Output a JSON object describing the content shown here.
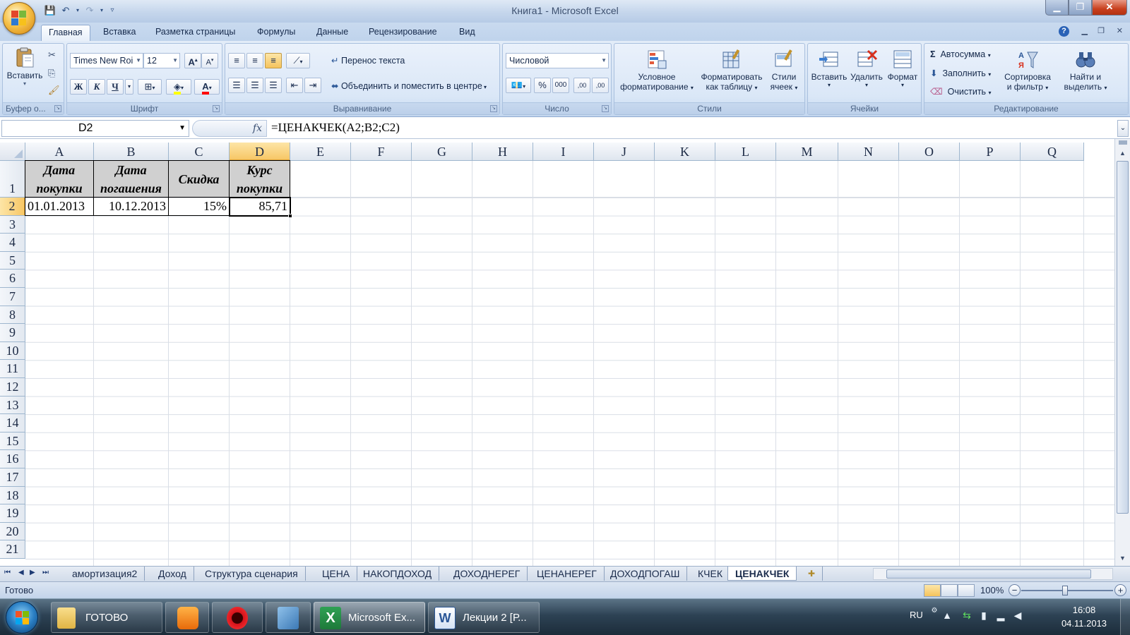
{
  "window": {
    "title": "Книга1 - Microsoft Excel",
    "minimize": "▁",
    "maximize": "❐",
    "close": "✕"
  },
  "ribbon_tabs": [
    "Главная",
    "Вставка",
    "Разметка страницы",
    "Формулы",
    "Данные",
    "Рецензирование",
    "Вид"
  ],
  "active_ribbon_tab": "Главная",
  "groups": {
    "clipboard": {
      "label": "Буфер о...",
      "paste": "Вставить"
    },
    "font": {
      "label": "Шрифт",
      "font_name": "Times New Roi",
      "font_size": "12",
      "bold": "Ж",
      "italic": "К",
      "underline": "Ч"
    },
    "alignment": {
      "label": "Выравнивание",
      "wrap_text": "Перенос текста",
      "merge_center": "Объединить и поместить в центре"
    },
    "number": {
      "label": "Число",
      "format": "Числовой",
      "percent": "%",
      "thousands": "000",
      "inc_decimal": ",00",
      "dec_decimal": ",00"
    },
    "styles": {
      "label": "Стили",
      "conditional_1": "Условное",
      "conditional_2": "форматирование",
      "format_table_1": "Форматировать",
      "format_table_2": "как таблицу",
      "cell_styles_1": "Стили",
      "cell_styles_2": "ячеек"
    },
    "cells": {
      "label": "Ячейки",
      "insert": "Вставить",
      "delete": "Удалить",
      "format": "Формат"
    },
    "editing": {
      "label": "Редактирование",
      "autosum": "Автосумма",
      "fill": "Заполнить",
      "clear": "Очистить",
      "sort_1": "Сортировка",
      "sort_2": "и фильтр",
      "find_1": "Найти и",
      "find_2": "выделить"
    }
  },
  "formula_bar": {
    "name_box": "D2",
    "fx": "fx",
    "formula": "=ЦЕНАКЧЕК(A2;B2;C2)"
  },
  "columns": [
    "A",
    "B",
    "C",
    "D",
    "E",
    "F",
    "G",
    "H",
    "I",
    "J",
    "K",
    "L",
    "M",
    "N",
    "O",
    "P",
    "Q"
  ],
  "rows": [
    "1",
    "2",
    "3",
    "4",
    "5",
    "6",
    "7",
    "8",
    "9",
    "10",
    "11",
    "12",
    "13",
    "14",
    "15",
    "16",
    "17",
    "18",
    "19",
    "20",
    "21"
  ],
  "selected_cell": "D2",
  "cells": {
    "A1": "Дата покупки",
    "B1": "Дата погашения",
    "C1": "Скидка",
    "D1": "Курс покупки",
    "A2": "01.01.2013",
    "B2": "10.12.2013",
    "C2": "15%",
    "D2": "85,71"
  },
  "sheet_tabs": [
    "амортизация2",
    "Доход",
    "Структура сценария",
    "ЦЕНА",
    "НАКОПДОХОД",
    "ДОХОДНЕРЕГ",
    "ЦЕНАНЕРЕГ",
    "ДОХОДПОГАШ",
    "КЧЕК",
    "ЦЕНАКЧЕК"
  ],
  "active_sheet": "ЦЕНАКЧЕК",
  "status": {
    "ready": "Готово",
    "zoom": "100%",
    "zoom_minus": "−",
    "zoom_plus": "+"
  },
  "taskbar": {
    "items": [
      {
        "label": "ГОТОВО",
        "icon": "folder-icon"
      },
      {
        "label": "",
        "icon": "media-player-icon"
      },
      {
        "label": "",
        "icon": "opera-icon"
      },
      {
        "label": "",
        "icon": "picture-viewer-icon"
      },
      {
        "label": "Microsoft Ex...",
        "icon": "excel-icon"
      },
      {
        "label": "Лекции 2 [Р...",
        "icon": "word-icon"
      }
    ],
    "language": "RU",
    "time": "16:08",
    "date": "04.11.2013"
  },
  "colors": {
    "ribbon_bg": "#d3e2f4",
    "selection_header": "#f7c766",
    "header_cell_fill": "#d0d0d0",
    "excel_green": "#1e7a3a"
  }
}
